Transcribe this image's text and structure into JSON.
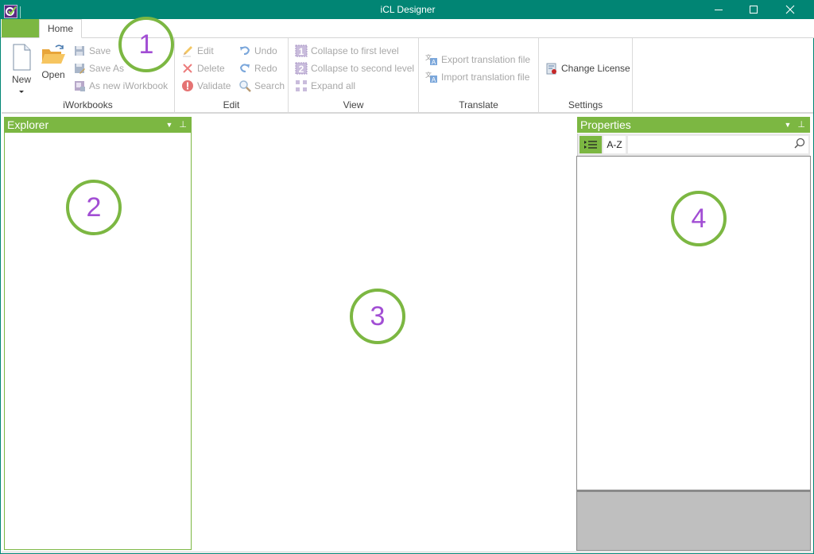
{
  "window": {
    "title": "iCL Designer",
    "controls": {
      "minimize": "minimize",
      "maximize": "maximize",
      "close": "close"
    }
  },
  "ribbon": {
    "tabs": [
      {
        "label": "Home",
        "active": true
      }
    ],
    "groups": {
      "iworkbooks": {
        "label": "iWorkbooks",
        "new_label": "New",
        "open_label": "Open",
        "save_label": "Save",
        "save_as_label": "Save As",
        "as_new_label": "As new iWorkbook"
      },
      "edit": {
        "label": "Edit",
        "edit_label": "Edit",
        "delete_label": "Delete",
        "validate_label": "Validate",
        "undo_label": "Undo",
        "redo_label": "Redo",
        "search_label": "Search"
      },
      "view": {
        "label": "View",
        "collapse_first_label": "Collapse to first level",
        "collapse_second_label": "Collapse to second level",
        "expand_all_label": "Expand all"
      },
      "translate": {
        "label": "Translate",
        "export_label": "Export translation file",
        "import_label": "Import translation file"
      },
      "settings": {
        "label": "Settings",
        "change_license_label": "Change License"
      }
    }
  },
  "explorer": {
    "title": "Explorer"
  },
  "properties": {
    "title": "Properties",
    "categorized_icon": "categorized-list-icon",
    "az_label": "A-Z",
    "search_value": "",
    "search_placeholder": ""
  },
  "annotations": [
    "1",
    "2",
    "3",
    "4"
  ],
  "colors": {
    "titlebar": "#018574",
    "accent_green": "#7cb742",
    "annotation_number": "#a24ed4",
    "disabled_text": "#a8a8a8",
    "description_pane": "#bfbfbf"
  }
}
